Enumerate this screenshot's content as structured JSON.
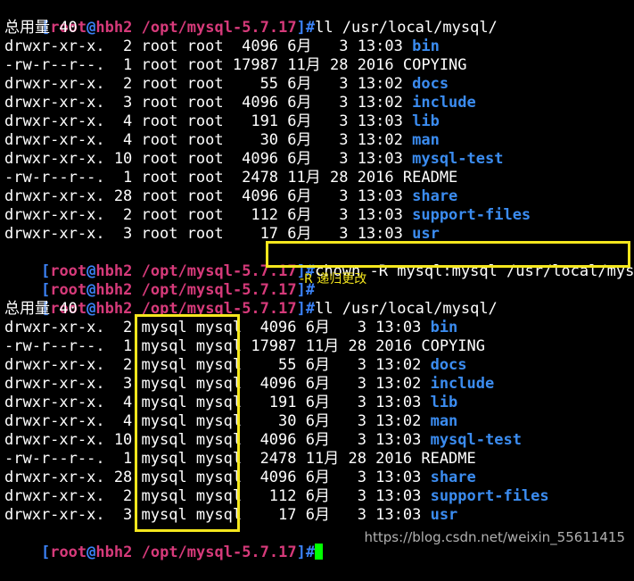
{
  "prompt": {
    "open": "[",
    "user": "root",
    "at": "@",
    "host": "hbh2",
    "path": "/opt/mysql-5.7.17",
    "close": "]#"
  },
  "commands": {
    "ll1": "ll /usr/local/mysql/",
    "chown": "chown -R mysql:mysql /usr/local/mysql/",
    "ll2": "ll /usr/local/mysql/"
  },
  "total_line": "总用量 40",
  "annotation": "-R 递归更改",
  "watermark": "https://blog.csdn.net/weixin_55611415",
  "listing_before": [
    {
      "meta": "drwxr-xr-x.  2 root root  4096 6月   3 13:03 ",
      "name": "bin",
      "is_dir": true
    },
    {
      "meta": "-rw-r--r--.  1 root root 17987 11月 28 2016 ",
      "name": "COPYING",
      "is_dir": false
    },
    {
      "meta": "drwxr-xr-x.  2 root root    55 6月   3 13:02 ",
      "name": "docs",
      "is_dir": true
    },
    {
      "meta": "drwxr-xr-x.  3 root root  4096 6月   3 13:02 ",
      "name": "include",
      "is_dir": true
    },
    {
      "meta": "drwxr-xr-x.  4 root root   191 6月   3 13:03 ",
      "name": "lib",
      "is_dir": true
    },
    {
      "meta": "drwxr-xr-x.  4 root root    30 6月   3 13:02 ",
      "name": "man",
      "is_dir": true
    },
    {
      "meta": "drwxr-xr-x. 10 root root  4096 6月   3 13:03 ",
      "name": "mysql-test",
      "is_dir": true
    },
    {
      "meta": "-rw-r--r--.  1 root root  2478 11月 28 2016 ",
      "name": "README",
      "is_dir": false
    },
    {
      "meta": "drwxr-xr-x. 28 root root  4096 6月   3 13:03 ",
      "name": "share",
      "is_dir": true
    },
    {
      "meta": "drwxr-xr-x.  2 root root   112 6月   3 13:03 ",
      "name": "support-files",
      "is_dir": true
    },
    {
      "meta": "drwxr-xr-x.  3 root root    17 6月   3 13:03 ",
      "name": "usr",
      "is_dir": true
    }
  ],
  "listing_after": [
    {
      "meta": "drwxr-xr-x.  2 mysql mysql  4096 6月   3 13:03 ",
      "name": "bin",
      "is_dir": true
    },
    {
      "meta": "-rw-r--r--.  1 mysql mysql 17987 11月 28 2016 ",
      "name": "COPYING",
      "is_dir": false
    },
    {
      "meta": "drwxr-xr-x.  2 mysql mysql    55 6月   3 13:02 ",
      "name": "docs",
      "is_dir": true
    },
    {
      "meta": "drwxr-xr-x.  3 mysql mysql  4096 6月   3 13:02 ",
      "name": "include",
      "is_dir": true
    },
    {
      "meta": "drwxr-xr-x.  4 mysql mysql   191 6月   3 13:03 ",
      "name": "lib",
      "is_dir": true
    },
    {
      "meta": "drwxr-xr-x.  4 mysql mysql    30 6月   3 13:02 ",
      "name": "man",
      "is_dir": true
    },
    {
      "meta": "drwxr-xr-x. 10 mysql mysql  4096 6月   3 13:03 ",
      "name": "mysql-test",
      "is_dir": true
    },
    {
      "meta": "-rw-r--r--.  1 mysql mysql  2478 11月 28 2016 ",
      "name": "README",
      "is_dir": false
    },
    {
      "meta": "drwxr-xr-x. 28 mysql mysql  4096 6月   3 13:03 ",
      "name": "share",
      "is_dir": true
    },
    {
      "meta": "drwxr-xr-x.  2 mysql mysql   112 6月   3 13:03 ",
      "name": "support-files",
      "is_dir": true
    },
    {
      "meta": "drwxr-xr-x.  3 mysql mysql    17 6月   3 13:03 ",
      "name": "usr",
      "is_dir": true
    }
  ],
  "colors": {
    "prompt": "#d63a7a",
    "bracket": "#3b82f6",
    "directory": "#3b8cf0",
    "highlight": "#f4e61d",
    "cursor": "#00ff00"
  }
}
